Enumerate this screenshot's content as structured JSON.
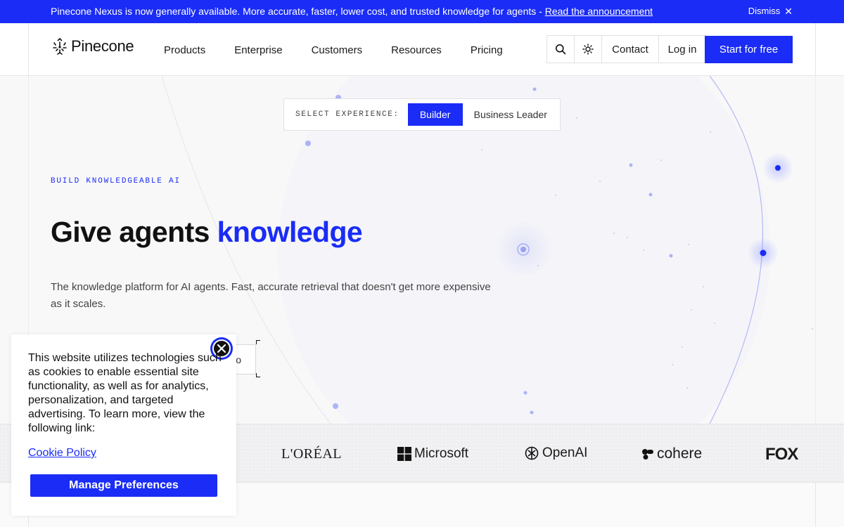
{
  "announcement": {
    "message": "Pinecone Nexus is now generally available. More accurate, faster, lower cost, and trusted knowledge for agents - ",
    "link": "Read the announcement",
    "dismiss": "Dismiss"
  },
  "header": {
    "logo_text": "Pinecone",
    "nav": [
      "Products",
      "Enterprise",
      "Customers",
      "Resources",
      "Pricing"
    ],
    "contact": "Contact",
    "login": "Log in",
    "cta": "Start for free"
  },
  "experience": {
    "label": "SELECT EXPERIENCE:",
    "options": [
      "Builder",
      "Business Leader"
    ],
    "selected": "Builder"
  },
  "hero": {
    "eyebrow": "BUILD KNOWLEDGEABLE AI",
    "headline_plain": "Give agents ",
    "headline_accent": "knowledge",
    "subheadline": "The knowledge platform for AI agents. Fast, accurate retrieval that doesn't get more expensive as it scales.",
    "demo_button_partial": "o"
  },
  "logos": [
    "L'ORÉAL",
    "Microsoft",
    "OpenAI",
    "cohere",
    "FOX"
  ],
  "cookie_banner": {
    "text": "This website utilizes technologies such as cookies to enable essential site functionality, as well as for analytics, personalization, and targeted advertising. To learn more, view the following link:",
    "link": "Cookie Policy",
    "button": "Manage Preferences"
  },
  "colors": {
    "brand_blue": "#1a2cf5",
    "background": "#f8f8f9",
    "text": "#111111"
  }
}
